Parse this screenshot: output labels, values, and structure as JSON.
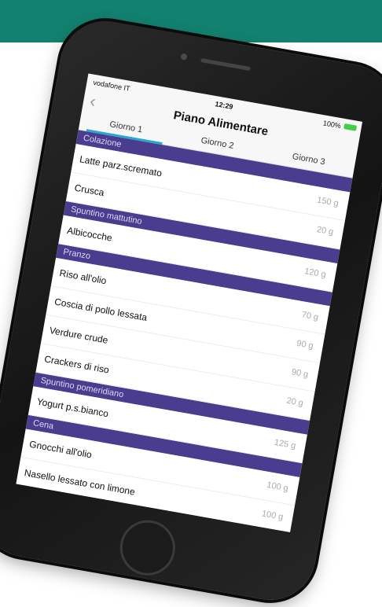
{
  "status_bar": {
    "carrier": "vodafone IT",
    "time": "12:29",
    "battery": "100%"
  },
  "nav": {
    "back_glyph": "‹",
    "title": "Piano Alimentare"
  },
  "tabs": [
    {
      "label": "Giorno 1",
      "active": true
    },
    {
      "label": "Giorno 2",
      "active": false
    },
    {
      "label": "Giorno 3",
      "active": false
    }
  ],
  "sections": [
    {
      "title": "Colazione",
      "items": [
        {
          "name": "Latte parz.scremato",
          "qty": "150 g"
        },
        {
          "name": "Crusca",
          "qty": "20 g"
        }
      ]
    },
    {
      "title": "Spuntino mattutino",
      "items": [
        {
          "name": "Albicocche",
          "qty": "120 g"
        }
      ]
    },
    {
      "title": "Pranzo",
      "items": [
        {
          "name": "Riso all'olio",
          "qty": "70 g"
        },
        {
          "name": "Coscia di pollo lessata",
          "qty": "90 g"
        },
        {
          "name": "Verdure crude",
          "qty": "90 g"
        },
        {
          "name": "Crackers di riso",
          "qty": "20 g"
        }
      ]
    },
    {
      "title": "Spuntino pomeridiano",
      "items": [
        {
          "name": "Yogurt p.s.bianco",
          "qty": "125 g"
        }
      ]
    },
    {
      "title": "Cena",
      "items": [
        {
          "name": "Gnocchi all'olio",
          "qty": "100 g"
        },
        {
          "name": "Nasello lessato con limone",
          "qty": "100 g"
        }
      ]
    }
  ],
  "colors": {
    "top_band": "#13816f",
    "section_header": "#4a3d8f",
    "tab_indicator": "#29a6d1",
    "battery": "#3fcf4a"
  },
  "icons": {
    "back": "chevron-left-icon",
    "signal": "signal-icon",
    "wifi": "wifi-icon",
    "bluetooth": "bluetooth-icon",
    "battery": "battery-icon"
  }
}
